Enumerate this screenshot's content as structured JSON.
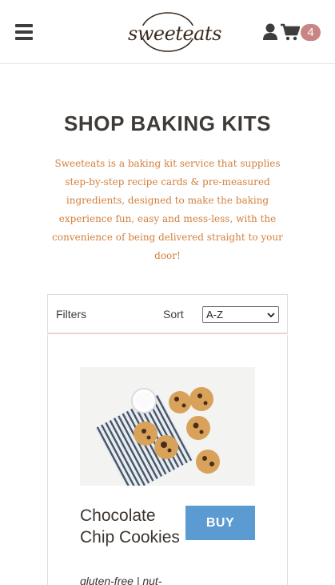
{
  "header": {
    "menu_icon": "hamburger-menu-icon",
    "logo_text": "sweeteats",
    "user_icon": "user-icon",
    "cart_icon": "shopping-cart-icon",
    "cart_count": "4",
    "badge_color": "#c98583"
  },
  "intro": {
    "title": "SHOP BAKING KITS",
    "description": "Sweeteats is a baking kit service that supplies step-by-step recipe cards & pre-measured ingredients, designed to make the baking experience fun, easy and mess-less, with the convenience of being delivered straight to your door!",
    "description_color": "#d37f3b"
  },
  "filters": {
    "filters_label": "Filters",
    "sort_label": "Sort",
    "sort_selected": "A-Z"
  },
  "products": [
    {
      "name": "Chocolate Chip Cookies",
      "buy_label": "BUY",
      "tags": "gluten-free | nut-",
      "image": "chocolate-chip-cookies-photo"
    }
  ],
  "colors": {
    "accent": "#5c9bd1",
    "text_dark": "#3c3530"
  }
}
